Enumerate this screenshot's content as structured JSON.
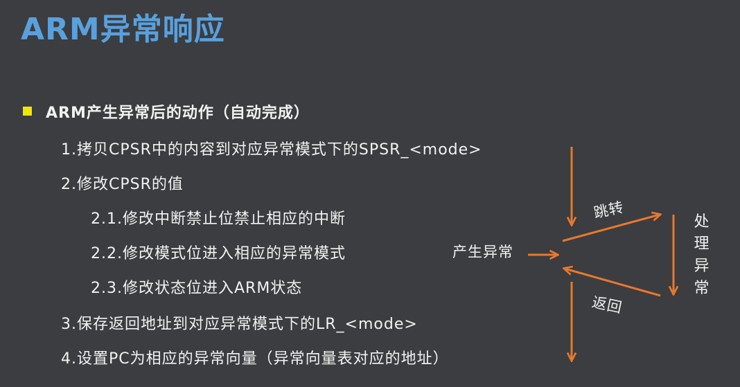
{
  "title": "ARM异常响应",
  "section": {
    "heading": "ARM产生异常后的动作（自动完成）",
    "items": [
      "1.拷贝CPSR中的内容到对应异常模式下的SPSR_<mode>",
      "2.修改CPSR的值",
      "2.1.修改中断禁止位禁止相应的中断",
      "2.2.修改模式位进入相应的异常模式",
      "2.3.修改状态位进入ARM状态",
      "3.保存返回地址到对应异常模式下的LR_<mode>",
      "4.设置PC为相应的异常向量（异常向量表对应的地址）"
    ]
  },
  "diagram": {
    "labels": {
      "generate": "产生异常",
      "jump": "跳转",
      "handle": "处理异常",
      "return": "返回"
    },
    "arrow_color": "#e8782e"
  }
}
